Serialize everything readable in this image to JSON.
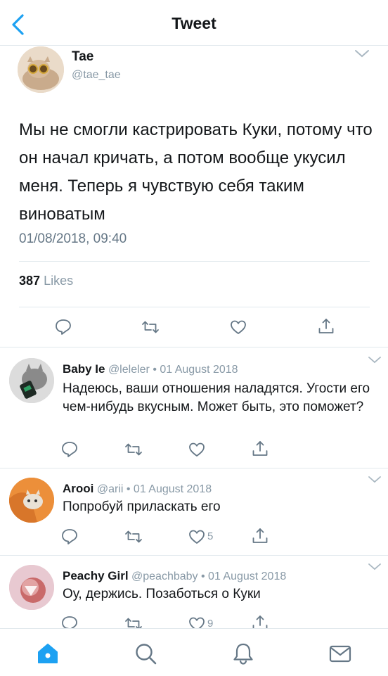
{
  "header": {
    "title": "Tweet",
    "back_icon": "chevron-left-icon"
  },
  "colors": {
    "accent": "#1da1f2",
    "muted": "#8899a6",
    "text": "#14171a",
    "separator": "#e1e8ed"
  },
  "main_tweet": {
    "name": "Tae",
    "handle": "@tae_tae",
    "text": "Мы не смогли кастрировать Куки, потому что он начал кричать, а потом вообще укусил меня. Теперь я чувствую себя таким виноватым",
    "timestamp": "01/08/2018, 09:40",
    "likes_count": "387",
    "likes_label": "Likes"
  },
  "replies": [
    {
      "name": "Baby Ie",
      "meta": "@leleler • 01 August 2018",
      "text": "Надеюсь, ваши отношения наладятся. Угости его чем-нибудь вкусным. Может быть, это поможет?",
      "like_count": ""
    },
    {
      "name": "Arooi",
      "meta": "@arii • 01 August 2018",
      "text": "Попробуй приласкать его",
      "like_count": "5"
    },
    {
      "name": "Peachy Girl",
      "meta": "@peachbaby • 01 August 2018",
      "text": "Оу, держись. Позаботься о Куки",
      "like_count": "9"
    }
  ],
  "tabbar": {
    "items": [
      "home-icon",
      "search-icon",
      "notifications-icon",
      "messages-icon"
    ],
    "active": "home-icon"
  }
}
